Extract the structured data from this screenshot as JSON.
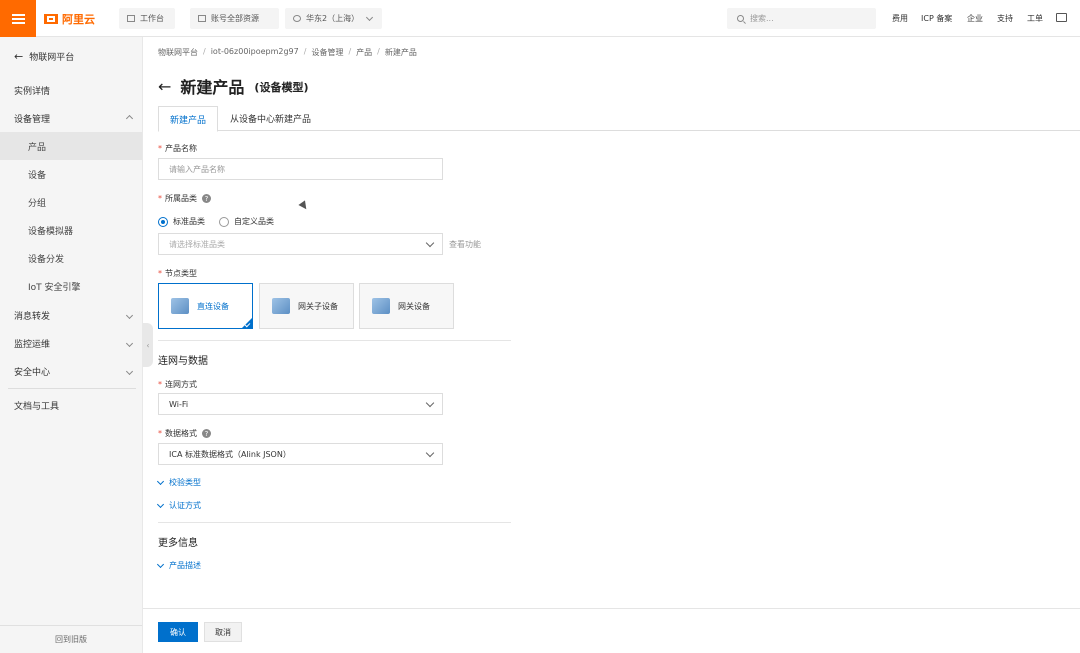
{
  "topbar": {
    "logo_text": "阿里云",
    "workbench": "工作台",
    "account": "账号全部资源",
    "region": "华东2（上海）",
    "search_placeholder": "搜索...",
    "links": [
      "费用",
      "ICP 备案",
      "企业",
      "支持",
      "工单"
    ]
  },
  "sidebar": {
    "back_label": "物联网平台",
    "items": [
      {
        "label": "实例详情"
      },
      {
        "label": "设备管理"
      },
      {
        "label": "产品"
      },
      {
        "label": "设备"
      },
      {
        "label": "分组"
      },
      {
        "label": "设备模拟器"
      },
      {
        "label": "设备分发"
      },
      {
        "label": "IoT 安全引擎"
      },
      {
        "label": "消息转发"
      },
      {
        "label": "监控运维"
      },
      {
        "label": "安全中心"
      },
      {
        "label": "文档与工具"
      }
    ],
    "footer": "回到旧版"
  },
  "breadcrumb": [
    "物联网平台",
    "iot-06z00ipoepm2g97",
    "设备管理",
    "产品",
    "新建产品"
  ],
  "page": {
    "title": "新建产品",
    "subtitle": "(设备模型)"
  },
  "tabs": [
    "新建产品",
    "从设备中心新建产品"
  ],
  "form": {
    "product_name_label": "产品名称",
    "product_name_placeholder": "请输入产品名称",
    "category_label": "所属品类",
    "radio_standard": "标准品类",
    "radio_custom": "自定义品类",
    "category_placeholder": "请选择标准品类",
    "category_link": "查看功能",
    "node_type_label": "节点类型",
    "node_types": [
      "直连设备",
      "网关子设备",
      "网关设备"
    ],
    "section_network": "连网与数据",
    "network_label": "连网方式",
    "network_value": "Wi-Fi",
    "format_label": "数据格式",
    "format_value": "ICA 标准数据格式（Alink JSON）",
    "verify_type": "校验类型",
    "auth_method": "认证方式",
    "section_more": "更多信息",
    "product_desc": "产品描述"
  },
  "footer": {
    "confirm": "确认",
    "cancel": "取消"
  }
}
